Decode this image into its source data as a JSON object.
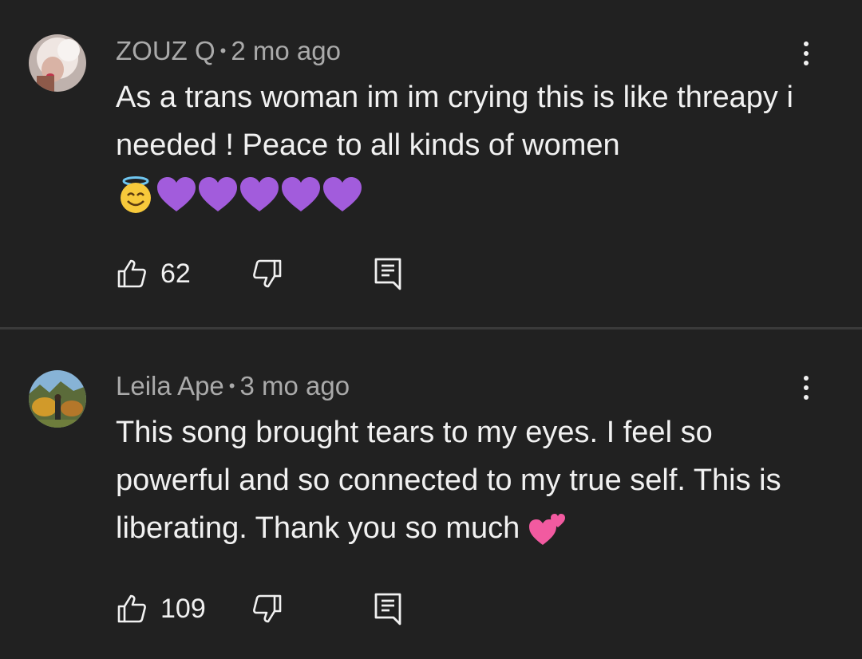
{
  "comments": [
    {
      "author": "ZOUZ Q",
      "separator": "•",
      "time": "2 mo ago",
      "text": "As a trans woman im im crying this is like threapy i needed ! Peace to all kinds of women",
      "emoji": [
        "smiling-face-with-halo",
        "purple-heart",
        "purple-heart",
        "purple-heart",
        "purple-heart",
        "purple-heart"
      ],
      "likes": "62",
      "avatar_colors": [
        "#d8c9c0",
        "#f3e7e2",
        "#a3776a"
      ]
    },
    {
      "author": "Leila Ape",
      "separator": "•",
      "time": "3 mo ago",
      "text": "This song brought tears to my eyes. I feel so powerful and so connected to my true self. This is liberating. Thank you so much",
      "emoji": [
        "two-hearts"
      ],
      "likes": "109",
      "avatar_colors": [
        "#7fa7c9",
        "#c58a2b",
        "#4d5b2a"
      ]
    }
  ],
  "colors": {
    "background": "#212121",
    "text_primary": "#f1f1f1",
    "text_secondary": "#aaaaaa",
    "divider": "#3a3a3a",
    "purple_heart": "#a25cdc",
    "pink_heart": "#f25aa0",
    "halo_face": "#f7c93b"
  },
  "icons": {
    "like": "thumb-up-icon",
    "dislike": "thumb-down-icon",
    "reply": "reply-comment-icon",
    "menu": "more-vert-icon"
  }
}
